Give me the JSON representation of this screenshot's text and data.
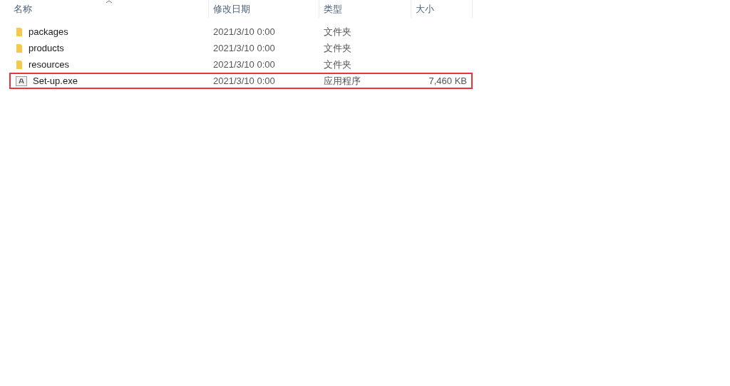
{
  "columns": [
    {
      "label": "名称",
      "sorted": true
    },
    {
      "label": "修改日期",
      "sorted": false
    },
    {
      "label": "类型",
      "sorted": false
    },
    {
      "label": "大小",
      "sorted": false
    }
  ],
  "rows": [
    {
      "kind": "folder",
      "name": "packages",
      "date": "2021/3/10 0:00",
      "type": "文件夹",
      "highlighted": false
    },
    {
      "kind": "folder",
      "name": "products",
      "date": "2021/3/10 0:00",
      "type": "文件夹",
      "highlighted": false
    },
    {
      "kind": "folder",
      "name": "resources",
      "date": "2021/3/10 0:00",
      "type": "文件夹",
      "highlighted": false
    },
    {
      "kind": "app",
      "name": "Set-up.exe",
      "date": "2021/3/10 0:00",
      "type": "应用程序",
      "size": "7,460 KB",
      "highlighted": true
    }
  ]
}
